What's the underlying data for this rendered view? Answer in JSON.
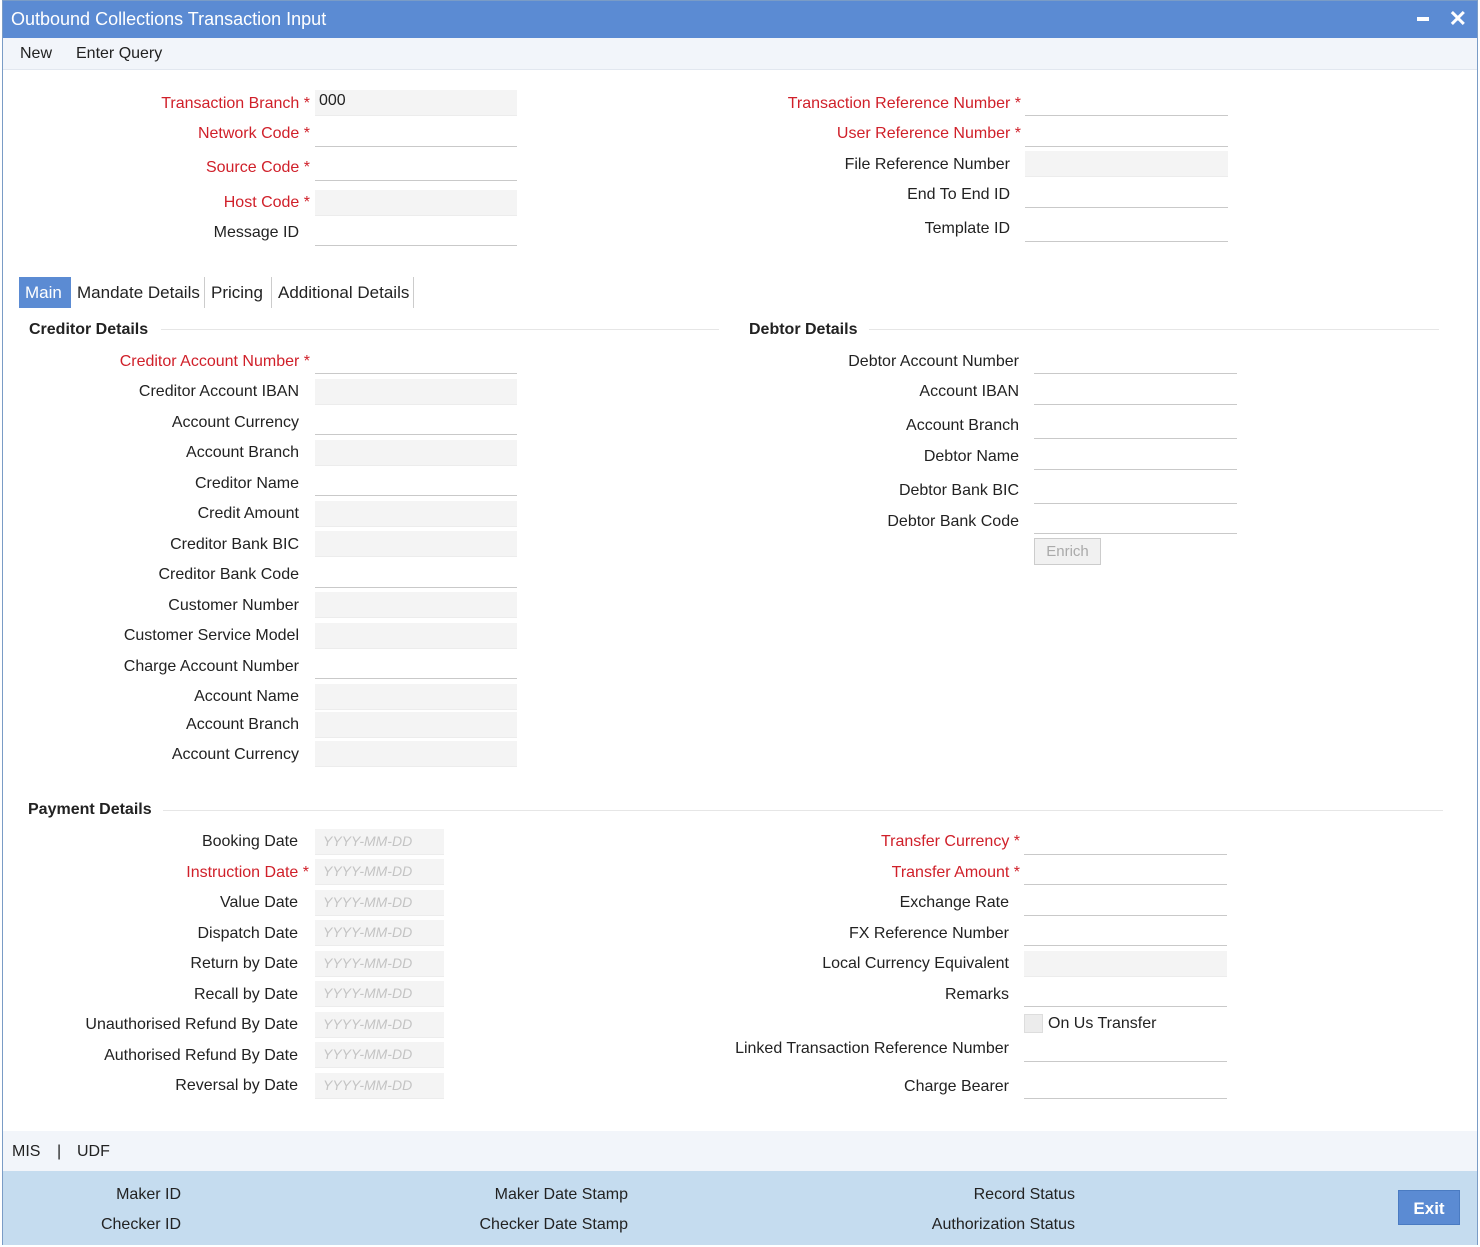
{
  "window": {
    "title": "Outbound Collections Transaction Input"
  },
  "menu": {
    "new": "New",
    "enter_query": "Enter Query"
  },
  "header": {
    "transaction_branch_label": "Transaction Branch",
    "transaction_branch_value": "000",
    "network_code_label": "Network Code",
    "source_code_label": "Source Code",
    "host_code_label": "Host Code",
    "message_id_label": "Message ID",
    "transaction_reference_label": "Transaction Reference Number",
    "user_reference_label": "User Reference Number",
    "file_reference_label": "File Reference Number",
    "end_to_end_label": "End To End ID",
    "template_id_label": "Template ID"
  },
  "tabs": [
    {
      "label": "Main",
      "active": true
    },
    {
      "label": "Mandate Details",
      "active": false
    },
    {
      "label": "Pricing",
      "active": false
    },
    {
      "label": "Additional Details",
      "active": false
    }
  ],
  "creditor": {
    "section_title": "Creditor Details",
    "account_number": "Creditor Account Number",
    "account_iban": "Creditor Account IBAN",
    "account_currency": "Account Currency",
    "account_branch": "Account Branch",
    "creditor_name": "Creditor Name",
    "credit_amount": "Credit Amount",
    "bank_bic": "Creditor Bank BIC",
    "bank_code": "Creditor Bank Code",
    "customer_number": "Customer Number",
    "customer_service_model": "Customer Service Model",
    "charge_account_number": "Charge Account Number",
    "account_name": "Account Name",
    "charge_account_branch": "Account Branch",
    "charge_account_currency": "Account Currency"
  },
  "debtor": {
    "section_title": "Debtor Details",
    "account_number": "Debtor Account Number",
    "account_iban": "Account IBAN",
    "account_branch": "Account Branch",
    "debtor_name": "Debtor Name",
    "bank_bic": "Debtor Bank BIC",
    "bank_code": "Debtor Bank Code",
    "enrich_button": "Enrich"
  },
  "payment": {
    "section_title": "Payment Details",
    "date_placeholder": "YYYY-MM-DD",
    "booking_date": "Booking Date",
    "instruction_date": "Instruction Date",
    "value_date": "Value Date",
    "dispatch_date": "Dispatch Date",
    "return_by_date": "Return by Date",
    "recall_by_date": "Recall by Date",
    "unauth_refund_date": "Unauthorised Refund By Date",
    "auth_refund_date": "Authorised Refund By Date",
    "reversal_by_date": "Reversal by Date",
    "transfer_currency": "Transfer Currency",
    "transfer_amount": "Transfer Amount",
    "exchange_rate": "Exchange Rate",
    "fx_reference": "FX Reference Number",
    "local_currency_equivalent": "Local Currency Equivalent",
    "remarks": "Remarks",
    "on_us_transfer": "On Us Transfer",
    "linked_transaction_reference": "Linked Transaction Reference Number",
    "charge_bearer": "Charge Bearer"
  },
  "links": {
    "mis": "MIS",
    "separator": "|",
    "udf": "UDF"
  },
  "footer": {
    "maker_id": "Maker ID",
    "checker_id": "Checker ID",
    "maker_date_stamp": "Maker Date Stamp",
    "checker_date_stamp": "Checker Date Stamp",
    "record_status": "Record Status",
    "authorization_status": "Authorization Status",
    "exit_button": "Exit"
  }
}
